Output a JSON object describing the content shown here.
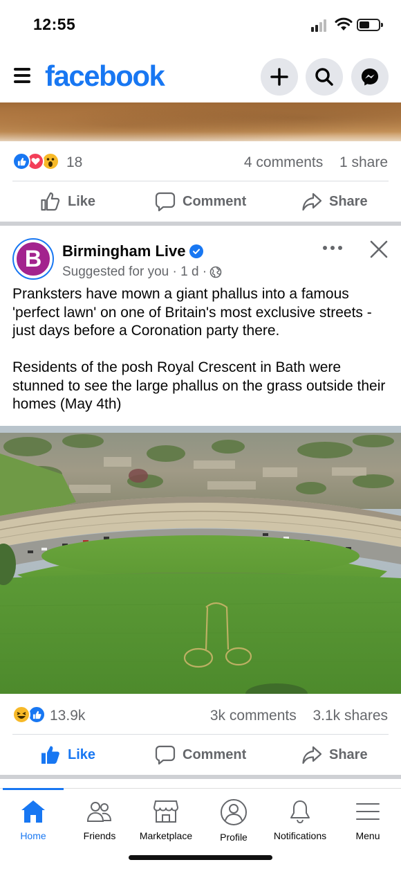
{
  "status_bar": {
    "time": "12:55"
  },
  "header": {
    "logo": "facebook",
    "icons": [
      "menu-icon",
      "plus-icon",
      "search-icon",
      "messenger-icon"
    ]
  },
  "prev_post": {
    "reaction_count": "18",
    "comments": "4 comments",
    "shares": "1 share",
    "actions": {
      "like": "Like",
      "comment": "Comment",
      "share": "Share"
    }
  },
  "post": {
    "page_name": "Birmingham Live",
    "avatar_letter": "B",
    "meta": "Suggested for you · 1 d ·",
    "text_paragraph_1": "Pranksters have mown a giant phallus into a famous 'perfect lawn' on one of Britain's most exclusive streets - just days before a Coronation party there.",
    "text_paragraph_2": "Residents of the posh Royal Crescent in Bath were stunned to see the large phallus on the grass outside their homes (May 4th)",
    "reaction_count": "13.9k",
    "comments": "3k comments",
    "shares": "3.1k shares",
    "actions": {
      "like": "Like",
      "comment": "Comment",
      "share": "Share"
    }
  },
  "bottom_nav": [
    {
      "label": "Home",
      "icon": "home-icon",
      "active": true
    },
    {
      "label": "Friends",
      "icon": "friends-icon",
      "active": false
    },
    {
      "label": "Marketplace",
      "icon": "marketplace-icon",
      "active": false
    },
    {
      "label": "Profile",
      "icon": "profile-icon",
      "active": false
    },
    {
      "label": "Notifications",
      "icon": "bell-icon",
      "active": false
    },
    {
      "label": "Menu",
      "icon": "menu-icon",
      "active": false
    }
  ],
  "colors": {
    "brand": "#1877f2",
    "secondary_text": "#65676b",
    "divider": "#ced0d4"
  }
}
